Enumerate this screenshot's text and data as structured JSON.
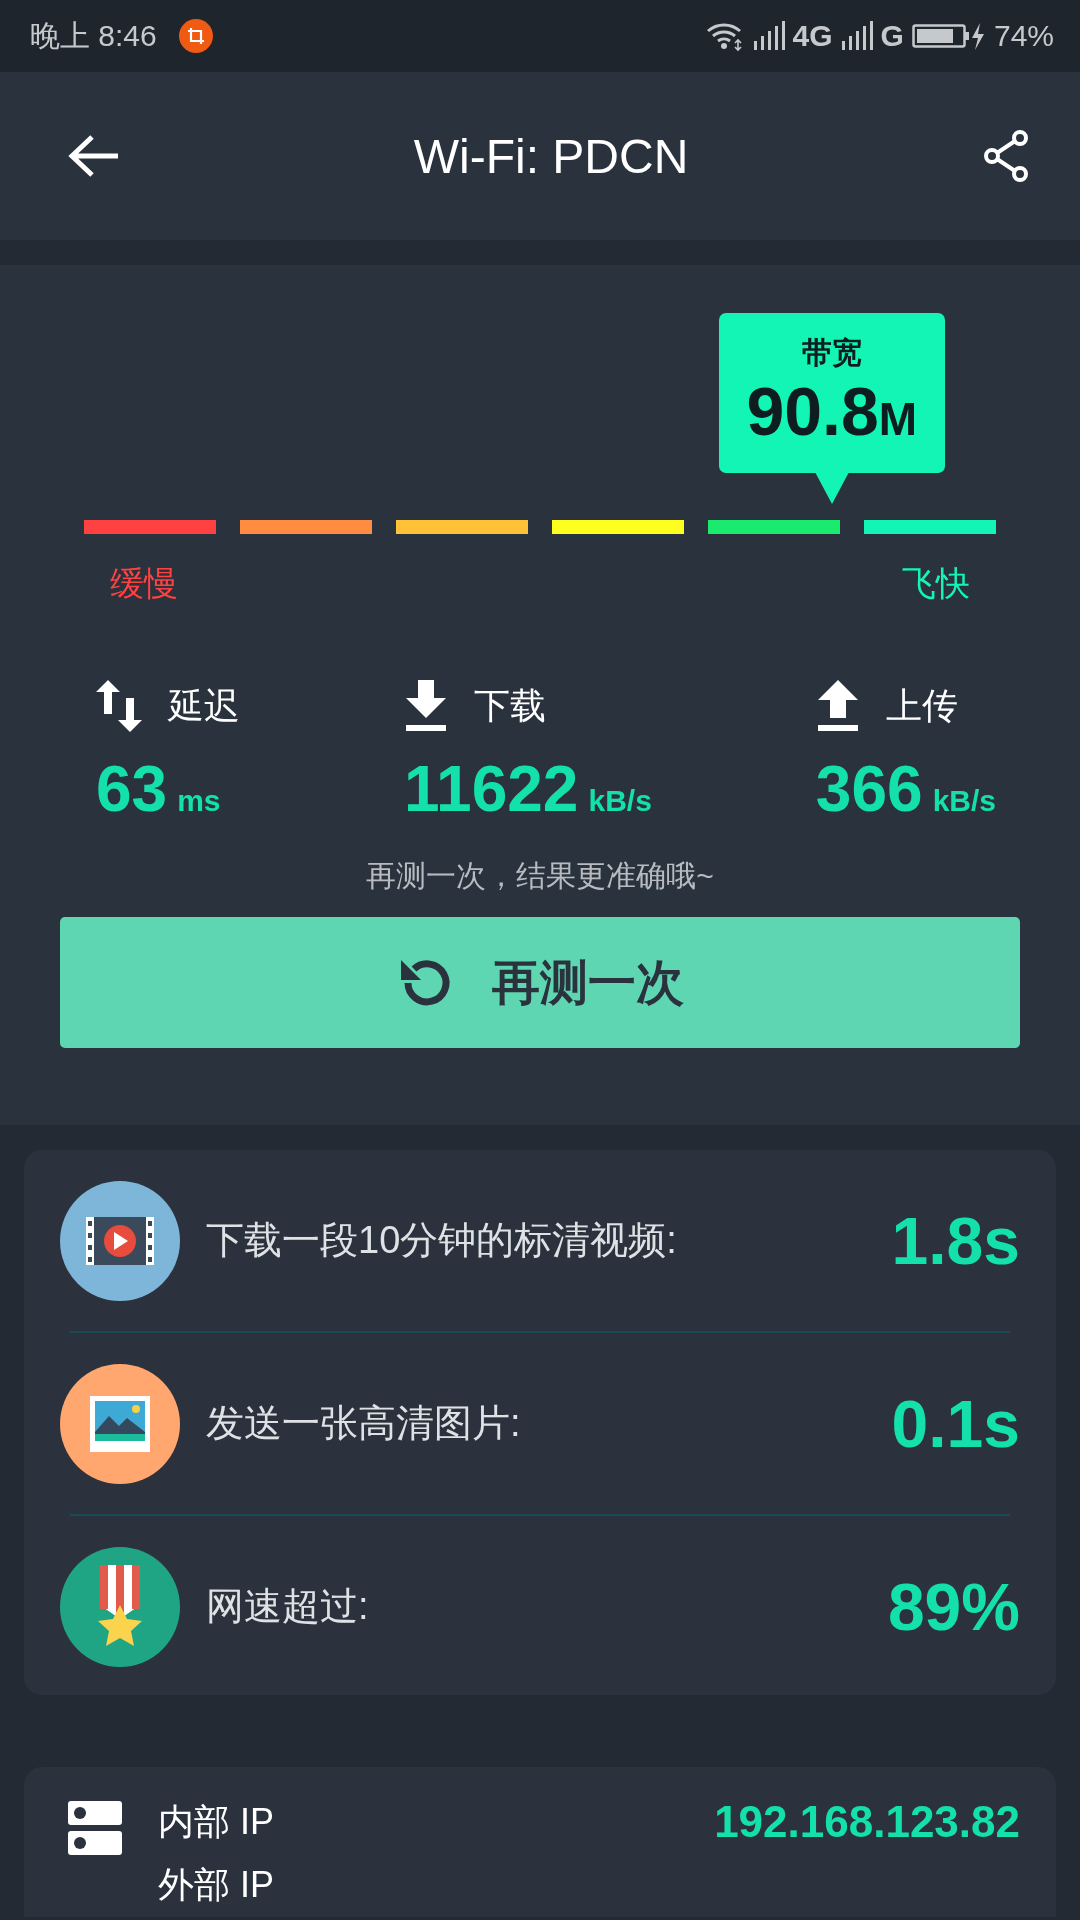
{
  "status_bar": {
    "time": "晚上 8:46",
    "network_1": "4G",
    "network_2": "G",
    "battery": "74%"
  },
  "header": {
    "title": "Wi-Fi: PDCN"
  },
  "bandwidth": {
    "label": "带宽",
    "value": "90.8",
    "unit": "M",
    "segments": [
      {
        "color": "#ff4141"
      },
      {
        "color": "#ff8c40"
      },
      {
        "color": "#ffc236"
      },
      {
        "color": "#ffff1f"
      },
      {
        "color": "#1aeb6e"
      },
      {
        "color": "#13f5b4"
      }
    ],
    "slow_label": "缓慢",
    "fast_label": "飞快"
  },
  "stats": [
    {
      "kind": "latency",
      "label": "延迟",
      "value": "63",
      "unit": "ms"
    },
    {
      "kind": "download",
      "label": "下载",
      "value": "11622",
      "unit": "kB/s"
    },
    {
      "kind": "upload",
      "label": "上传",
      "value": "366",
      "unit": "kB/s"
    }
  ],
  "hint": "再测一次，结果更准确哦~",
  "retest_button": "再测一次",
  "results": [
    {
      "kind": "video",
      "label": "下载一段10分钟的标清视频:",
      "value": "1.8s"
    },
    {
      "kind": "picture",
      "label": "发送一张高清图片:",
      "value": "0.1s"
    },
    {
      "kind": "medal",
      "label": "网速超过:",
      "value": "89%"
    }
  ],
  "ip_info": [
    {
      "label": "内部 IP",
      "value": "192.168.123.82"
    },
    {
      "label": "外部 IP"
    }
  ]
}
